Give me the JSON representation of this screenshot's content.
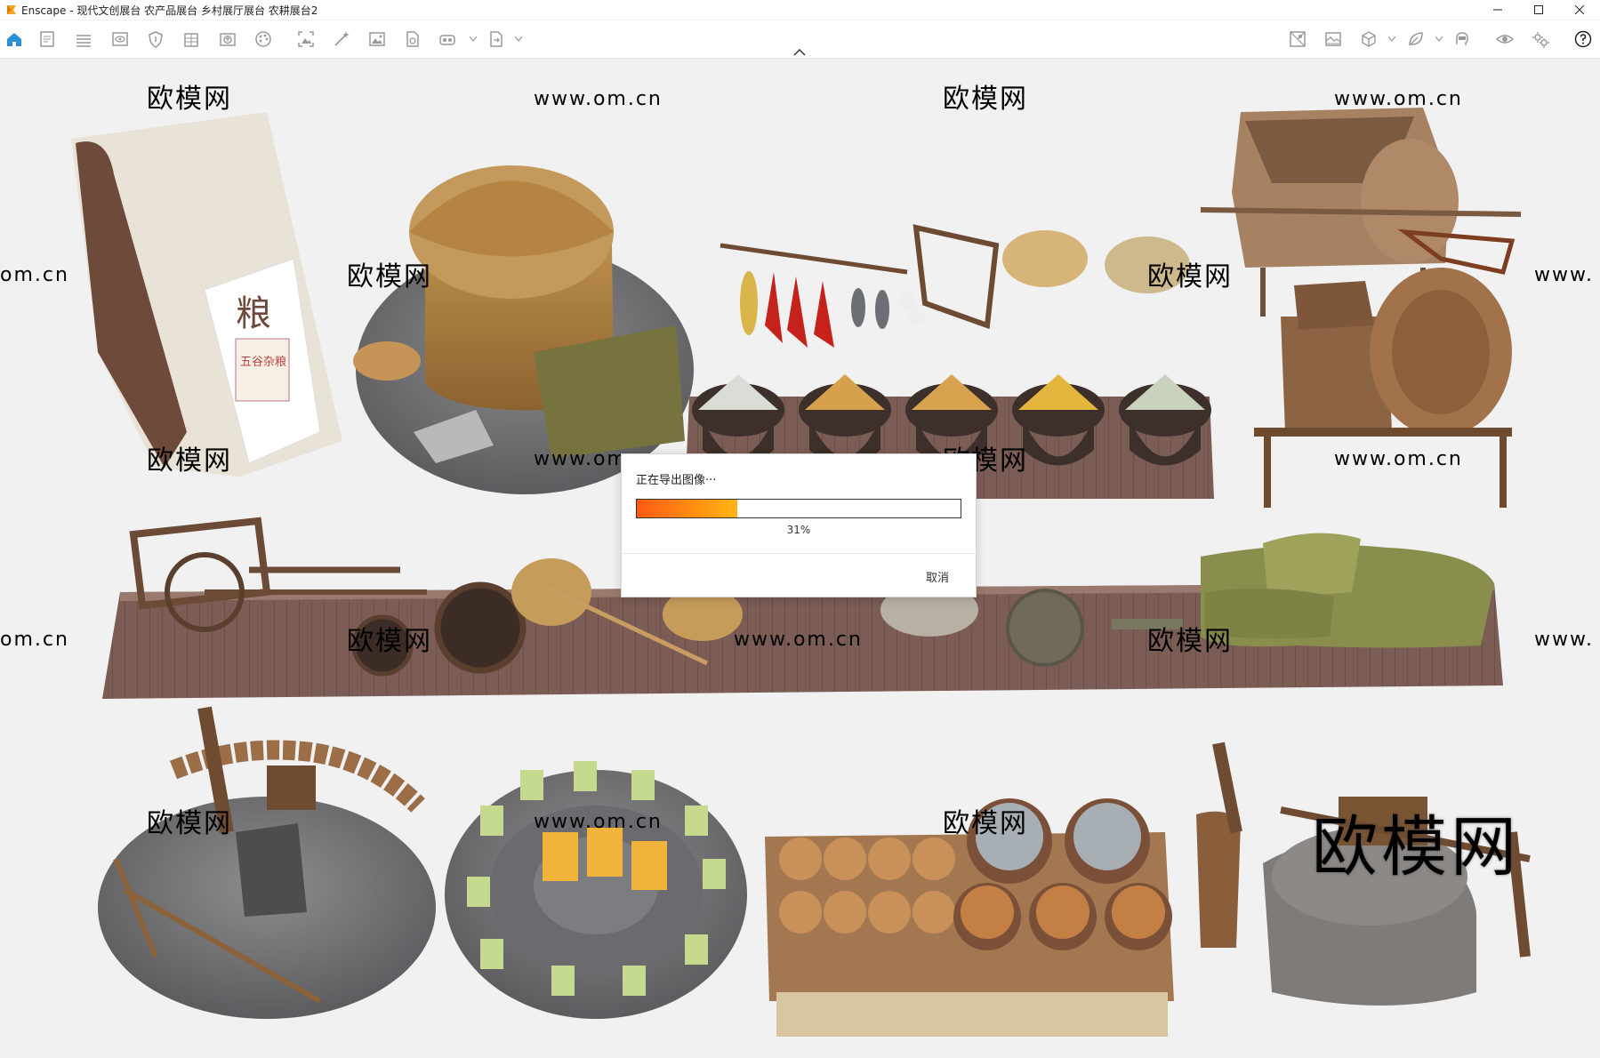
{
  "window": {
    "title": "Enscape - 现代文创展台 农产品展台 乡村展厅展台 农耕展台2",
    "controls": [
      "minimize-icon",
      "maximize-icon",
      "close-icon"
    ]
  },
  "toolbar": {
    "left_icons": [
      "home-icon",
      "document-icon",
      "bim-icon",
      "view-icon",
      "shield-icon",
      "building-icon",
      "upload-icon",
      "palette-icon",
      "screenshot-icon",
      "wand-icon",
      "image-icon",
      "export-file-icon",
      "batch-render-icon",
      "export-icon"
    ],
    "right_icons": [
      "map-icon",
      "panorama-icon",
      "cube-icon",
      "leaf-icon",
      "head-icon",
      "eye-icon",
      "settings-icon",
      "help-icon"
    ],
    "accent_color": "#2b8fd6"
  },
  "watermarks": {
    "cn": "欧模网",
    "url": "www.om.cn",
    "url_partial": "om.cn",
    "url_prefix": "www."
  },
  "scene": {
    "sign_character": "粮",
    "sign_subtitle": "五谷杂粮"
  },
  "dialog": {
    "title": "正在导出图像···",
    "progress": 31,
    "progress_text": "31%",
    "cancel_label": "取消"
  }
}
